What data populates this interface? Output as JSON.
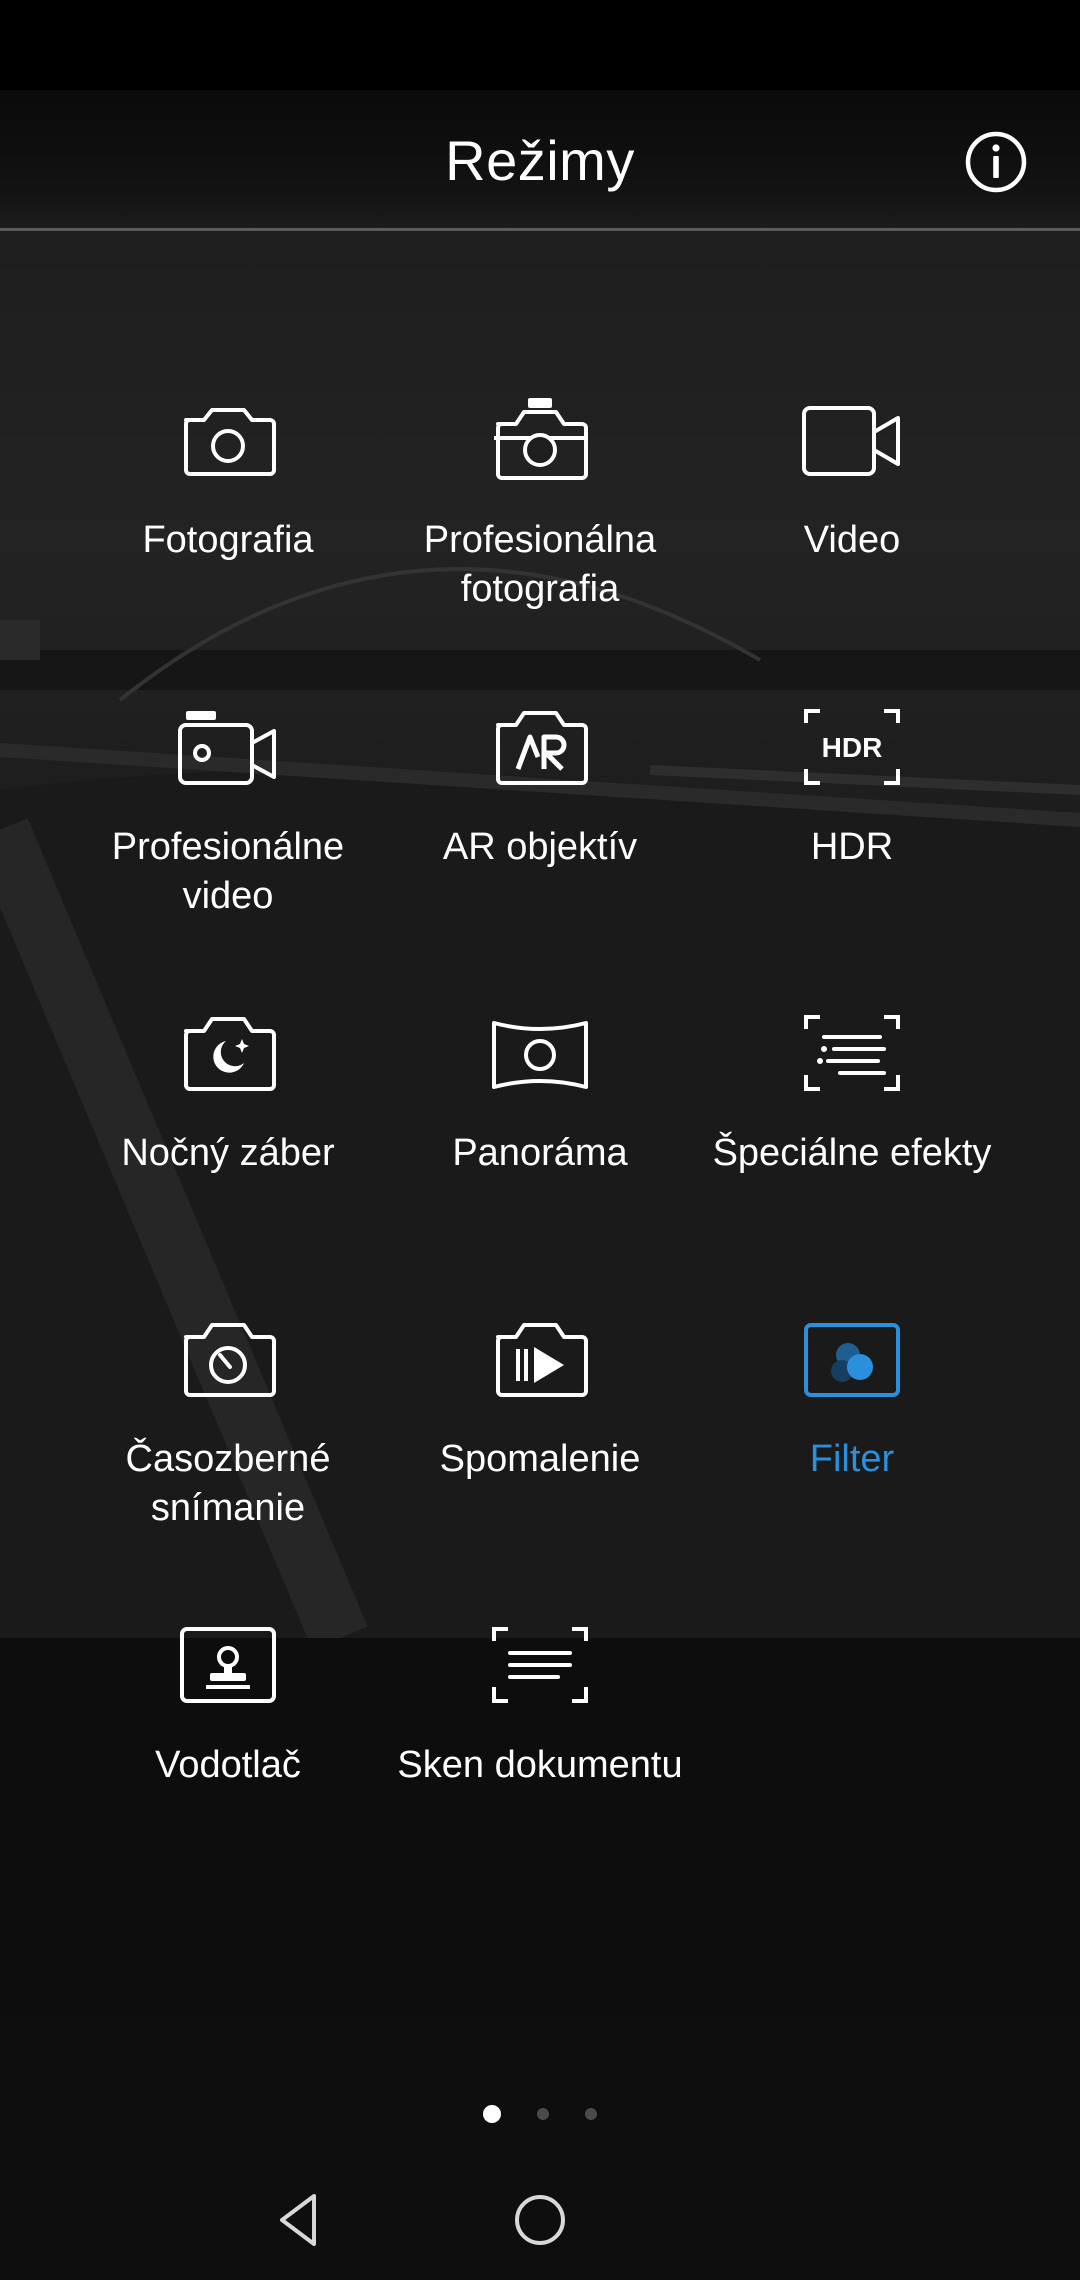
{
  "header": {
    "title": "Režimy",
    "info_icon": "info-circle-icon"
  },
  "modes": [
    {
      "label": "Fotografia",
      "icon": "camera-icon",
      "active": false
    },
    {
      "label": "Profesionálna fotografia",
      "icon": "pro-camera-icon",
      "active": false
    },
    {
      "label": "Video",
      "icon": "video-camera-icon",
      "active": false
    },
    {
      "label": "Profesionálne video",
      "icon": "pro-video-icon",
      "active": false
    },
    {
      "label": "AR objektív",
      "icon": "ar-lens-icon",
      "active": false
    },
    {
      "label": "HDR",
      "icon": "hdr-icon",
      "active": false
    },
    {
      "label": "Nočný záber",
      "icon": "night-shot-icon",
      "active": false
    },
    {
      "label": "Panoráma",
      "icon": "panorama-icon",
      "active": false
    },
    {
      "label": "Špeciálne efekty",
      "icon": "special-effects-icon",
      "active": false
    },
    {
      "label": "Časozberné snímanie",
      "icon": "time-lapse-icon",
      "active": false
    },
    {
      "label": "Spomalenie",
      "icon": "slow-motion-icon",
      "active": false
    },
    {
      "label": "Filter",
      "icon": "filter-icon",
      "active": true
    },
    {
      "label": "Vodotlač",
      "icon": "watermark-icon",
      "active": false
    },
    {
      "label": "Sken dokumentu",
      "icon": "document-scan-icon",
      "active": false
    }
  ],
  "pager": {
    "pages": 3,
    "current": 1
  },
  "colors": {
    "accent": "#2a8fdc",
    "text": "#ffffff",
    "background": "#0b0b0b"
  },
  "nav": {
    "back_icon": "back-triangle-icon",
    "home_icon": "home-circle-icon"
  }
}
